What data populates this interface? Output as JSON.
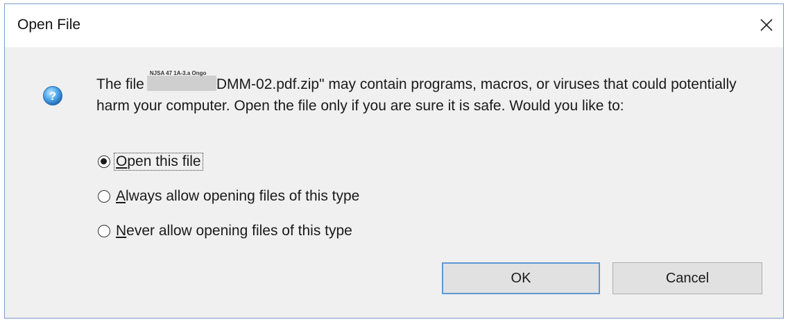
{
  "dialog": {
    "title": "Open File",
    "message": {
      "prefix": "The file",
      "redacted_overlay": "NJSA 47 1A-3.a Ongo",
      "suffix": "DMM-02.pdf.zip\" may contain programs, macros, or viruses that could potentially harm your computer. Open the file only if you are sure it is safe. Would you like to:"
    },
    "options": [
      {
        "accel": "O",
        "rest": "pen this file",
        "selected": true
      },
      {
        "accel": "A",
        "rest": "lways allow opening files of this type",
        "selected": false
      },
      {
        "accel": "N",
        "rest": "ever allow opening files of this type",
        "selected": false
      }
    ],
    "buttons": {
      "ok": "OK",
      "cancel": "Cancel"
    },
    "icon": "question-icon",
    "close_icon": "close-icon"
  }
}
